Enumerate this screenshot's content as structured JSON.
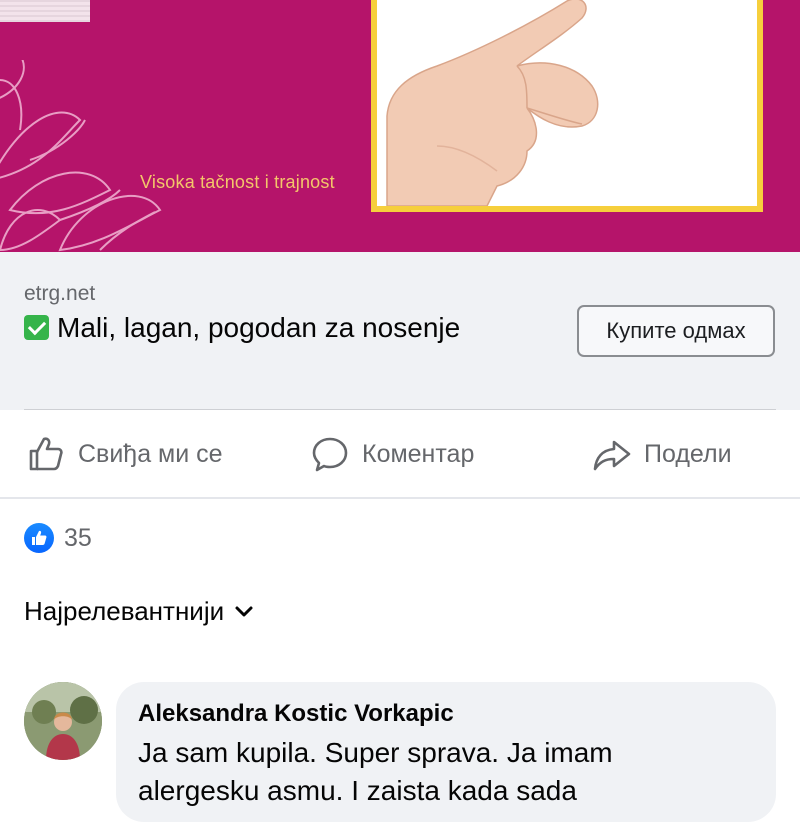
{
  "ad": {
    "tagline": "Visoka tačnost i trajnost",
    "colors": {
      "background": "#b5146a",
      "frame": "#f6cf3c",
      "tagline": "#f3c66a"
    }
  },
  "link_preview": {
    "domain": "etrg.net",
    "title": "Mali, lagan, pogodan za nosenje",
    "title_icon": "check-mark-emoji",
    "cta_label": "Купите одмах"
  },
  "actions": {
    "like_label": "Свиђа ми се",
    "comment_label": "Коментар",
    "share_label": "Подели"
  },
  "reactions": {
    "count": "35",
    "icon": "like-icon",
    "color": "#0866ff"
  },
  "sort": {
    "label": "Најрелевантнији"
  },
  "comments": [
    {
      "author": "Aleksandra Kostic Vorkapic",
      "lines": [
        "Ja sam kupila. Super sprava. Ja imam",
        "alergesku asmu. I zaista kada sada"
      ]
    }
  ]
}
